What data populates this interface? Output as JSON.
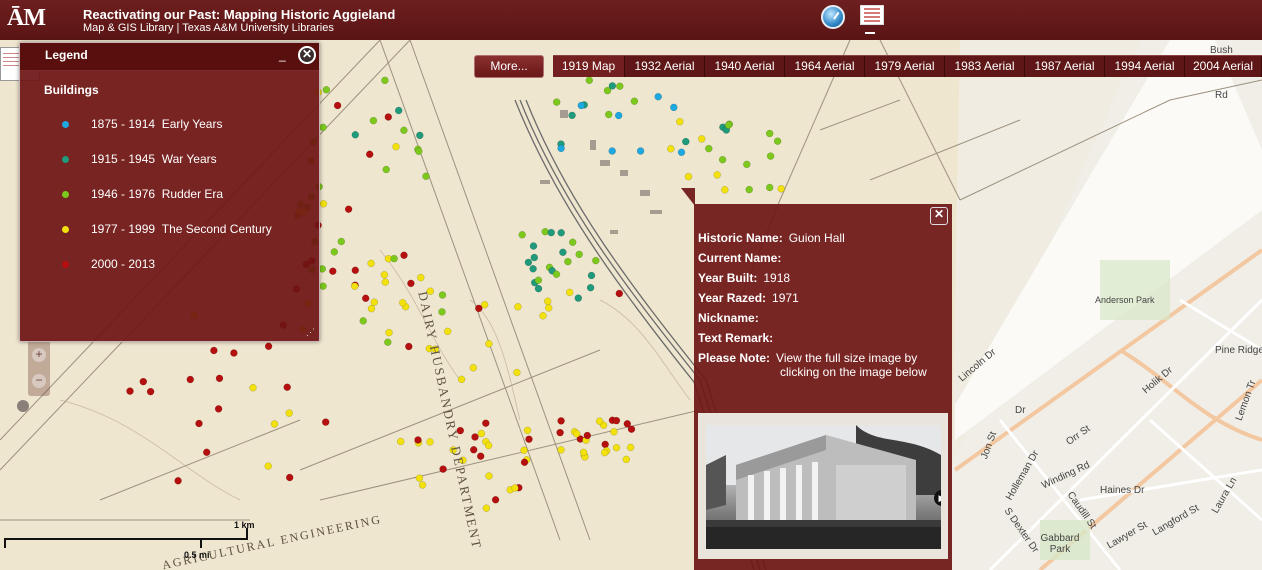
{
  "header": {
    "logo_text": "ĀM",
    "title": "Reactivating our Past: Mapping Historic Aggieland",
    "subtitle": "Map & GIS Library | Texas A&M University Libraries",
    "icons": [
      "gauge-icon",
      "legend-toggle-icon"
    ]
  },
  "legend": {
    "title": "Legend",
    "minimize_label": "_",
    "close_label": "✕",
    "section": "Buildings",
    "items": [
      {
        "range": "1875 - 1914",
        "name": "Early Years",
        "color": "#1ea8e0"
      },
      {
        "range": "1915 - 1945",
        "name": "War Years",
        "color": "#1f9a7a"
      },
      {
        "range": "1946 - 1976",
        "name": "Rudder Era",
        "color": "#7cc81d"
      },
      {
        "range": "1977 - 1999",
        "name": "The Second Century",
        "color": "#f2e10d"
      },
      {
        "range": "2000 - 2013",
        "name": "",
        "color": "#b50f0f"
      }
    ]
  },
  "toolbar": {
    "more_label": "More...",
    "tabs": [
      "1919 Map",
      "1932 Aerial",
      "1940 Aerial",
      "1964 Aerial",
      "1979 Aerial",
      "1983 Aerial",
      "1987 Aerial",
      "1994 Aerial",
      "2004 Aerial"
    ],
    "active_tab": "1919 Map"
  },
  "popup": {
    "close_label": "✕",
    "fields": [
      {
        "label": "Historic Name:",
        "value": "Guion Hall"
      },
      {
        "label": "Current Name:",
        "value": ""
      },
      {
        "label": "Year Built:",
        "value": "1918"
      },
      {
        "label": "Year Razed:",
        "value": "1971"
      },
      {
        "label": "Nickname:",
        "value": ""
      },
      {
        "label": "Text Remark:",
        "value": ""
      },
      {
        "label": "Please Note:",
        "value": "View the full size image by"
      }
    ],
    "note_line2": "clicking on the image below",
    "next_label": "▶"
  },
  "scale": {
    "km_label": "1 km",
    "mi_label": "0.5 mi"
  },
  "map_labels": {
    "streets": [
      "Pine Ridge",
      "Holik Dr",
      "Lemon Tr",
      "Orr St",
      "Winding Rd",
      "Haines Dr",
      "Langford St",
      "Laura Ln",
      "Holleman Dr",
      "Caudill St",
      "Lawyer St",
      "S Dexter Dr",
      "Gabbard Park",
      "Dr",
      "Rd",
      "Bush",
      "Jon St",
      "Anderson Park",
      "Lincoln Dr"
    ],
    "historic_text": [
      "DAIRY HUSBANDRY DEPARTMENT",
      "AGRICULTURAL ENGINEERING"
    ]
  },
  "colors": {
    "maroon": "#6e1f1f",
    "panel": "#6e1616"
  }
}
